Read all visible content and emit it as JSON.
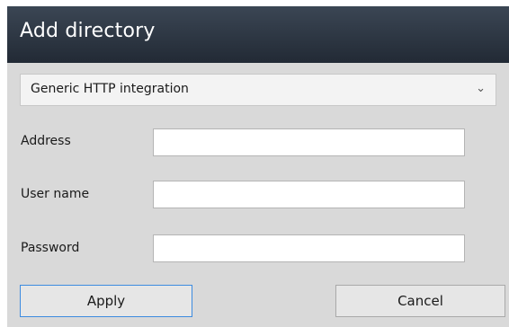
{
  "dialog": {
    "title": "Add directory"
  },
  "integration_select": {
    "selected": "Generic HTTP integration",
    "chevron_icon": "chevron-down-icon"
  },
  "form": {
    "address": {
      "label": "Address",
      "value": ""
    },
    "username": {
      "label": "User name",
      "value": ""
    },
    "password": {
      "label": "Password",
      "value": ""
    }
  },
  "buttons": {
    "apply": "Apply",
    "cancel": "Cancel"
  },
  "colors": {
    "titlebar_top": "#3b4654",
    "titlebar_bottom": "#222a35",
    "dialog_background": "#d9d9d9",
    "focus_border": "#3c8be0"
  }
}
